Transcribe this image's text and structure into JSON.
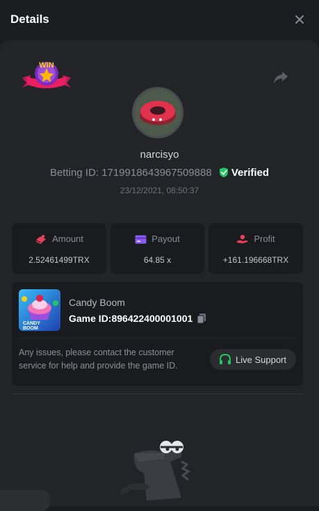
{
  "header": {
    "title": "Details"
  },
  "user": {
    "username": "narcisyo",
    "betting_id_label": "Betting ID:",
    "betting_id": "1719918643967509888",
    "verified_label": "Verified",
    "timestamp": "23/12/2021, 08:50:37",
    "badge_text": "WIN"
  },
  "stats": {
    "amount": {
      "label": "Amount",
      "value": "2.52461499TRX"
    },
    "payout": {
      "label": "Payout",
      "value": "64.85 x"
    },
    "profit": {
      "label": "Profit",
      "value": "+161.196668TRX"
    }
  },
  "game": {
    "name": "Candy Boom",
    "id_label": "Game ID:",
    "id_value": "896422400001001",
    "thumb_text_1": "CANDY",
    "thumb_text_2": "BOOM",
    "contact_text": "Any issues, please contact the customer service for help and provide the game ID.",
    "support_label": "Live Support"
  },
  "colors": {
    "accent_green": "#22c55e",
    "amount_icon": "#e8425a",
    "payout_icon": "#8b5cf6",
    "profit_icon": "#e8425a"
  },
  "icons": [
    "close-icon",
    "share-icon",
    "verified-shield-icon",
    "amount-icon",
    "payout-card-icon",
    "profit-icon",
    "copy-icon",
    "headset-icon"
  ]
}
